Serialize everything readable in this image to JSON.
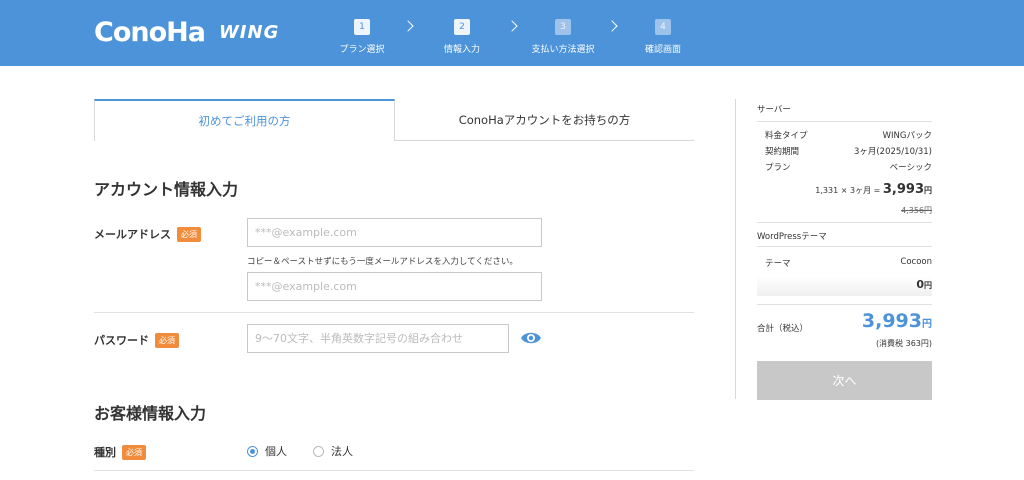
{
  "header": {
    "logo_main": "ConoHa",
    "logo_sub": "WING",
    "steps": [
      {
        "num": "1",
        "label": "プラン選択"
      },
      {
        "num": "2",
        "label": "情報入力"
      },
      {
        "num": "3",
        "label": "支払い方法選択"
      },
      {
        "num": "4",
        "label": "確認画面"
      }
    ],
    "accent_color": "#4d93d9"
  },
  "tabs": [
    {
      "label": "初めてご利用の方",
      "active": true
    },
    {
      "label": "ConoHaアカウントをお持ちの方",
      "active": false
    }
  ],
  "account_section": {
    "title": "アカウント情報入力",
    "email": {
      "label": "メールアドレス",
      "badge": "必須",
      "placeholder": "***@example.com",
      "hint": "コピー＆ペーストせずにもう一度メールアドレスを入力してください。",
      "confirm_placeholder": "***@example.com"
    },
    "password": {
      "label": "パスワード",
      "badge": "必須",
      "placeholder": "9〜70文字、半角英数字記号の組み合わせ",
      "toggle_icon": "eye-icon"
    }
  },
  "customer_section": {
    "title": "お客様情報入力",
    "type": {
      "label": "種別",
      "badge": "必須",
      "options": [
        {
          "label": "個人",
          "checked": true
        },
        {
          "label": "法人",
          "checked": false
        }
      ]
    }
  },
  "sidebar": {
    "server_heading": "サーバー",
    "rows": [
      {
        "key": "料金タイプ",
        "value": "WINGパック"
      },
      {
        "key": "契約期間",
        "value": "3ヶ月(2025/10/31)"
      },
      {
        "key": "プラン",
        "value": "ベーシック"
      }
    ],
    "price_formula": "1,331 × 3ヶ月 =",
    "price": "3,993",
    "yen": "円",
    "old_price": "4,356円",
    "wp_heading": "WordPressテーマ",
    "theme_row": {
      "key": "テーマ",
      "value": "Cocoon"
    },
    "theme_price": "0",
    "total_label": "合計（税込）",
    "total": "3,993",
    "tax": "(消費税 363円)",
    "next_button": "次へ"
  }
}
